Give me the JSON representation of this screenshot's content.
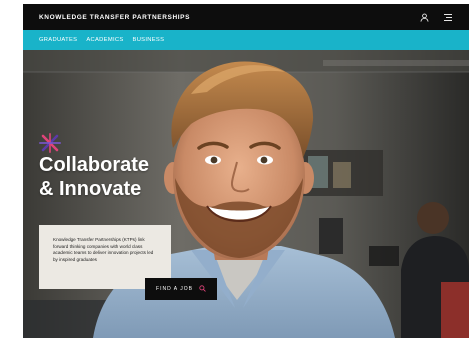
{
  "header": {
    "brand": "KNOWLEDGE TRANSFER PARTNERSHIPS",
    "icons": [
      "user-icon",
      "menu-icon"
    ]
  },
  "nav": {
    "items": [
      {
        "label": "GRADUATES"
      },
      {
        "label": "ACADEMICS"
      },
      {
        "label": "BUSINESS"
      }
    ]
  },
  "hero": {
    "headline_line1": "Collaborate",
    "headline_line2": "& Innovate",
    "description": "Knowledge Transfer Partnerships (KTPs) link forward thinking companies with world class academic teams to deliver innovation projects led by inspired graduates",
    "cta_label": "FIND A JOB",
    "cta_icon": "search-icon"
  },
  "colors": {
    "accent": "#19b3c9",
    "header_bg": "#0d0d0d",
    "card_bg": "#ece9e3",
    "logo_pink": "#e0447a",
    "logo_purple": "#5a3aa8"
  }
}
